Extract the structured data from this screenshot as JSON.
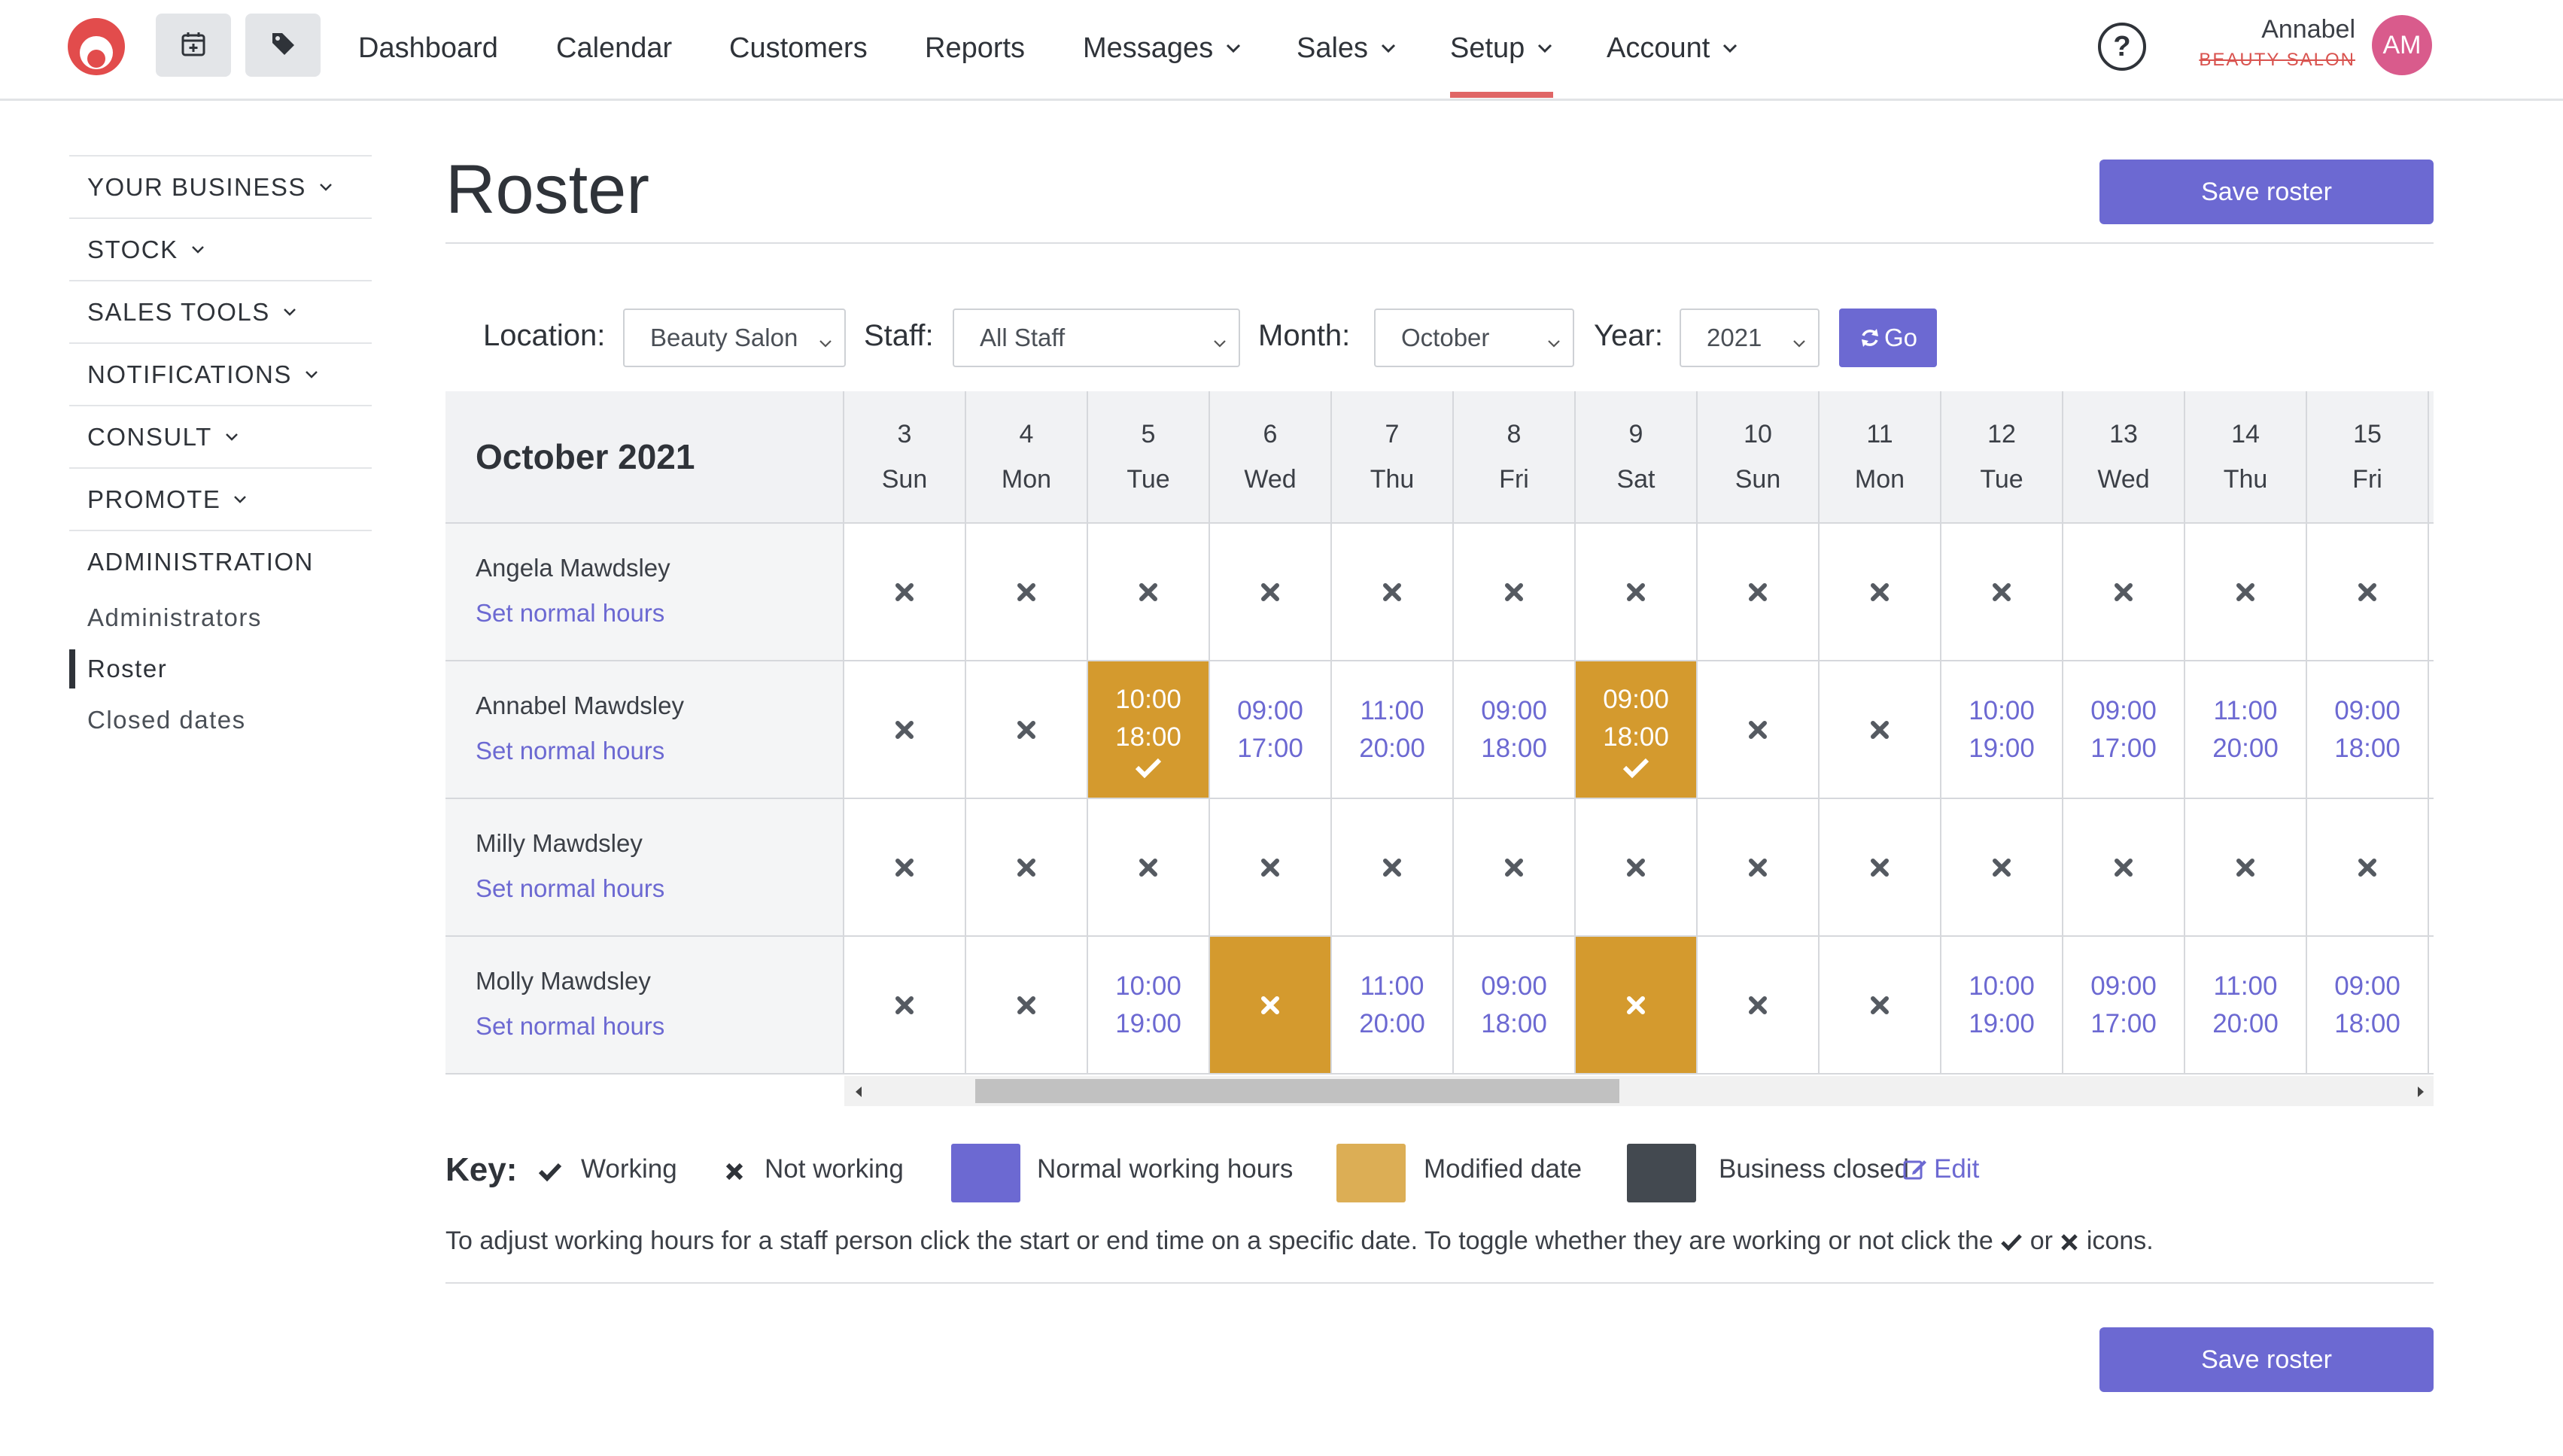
{
  "colors": {
    "accent": "#6c69d2",
    "modified": "#d49a2e",
    "modified_key": "#dcae55",
    "closed": "#434950",
    "active_underline": "#e06666"
  },
  "nav": {
    "icons": [
      "calendar-plus-icon",
      "tag-icon"
    ],
    "items": [
      {
        "label": "Dashboard"
      },
      {
        "label": "Calendar"
      },
      {
        "label": "Customers"
      },
      {
        "label": "Reports"
      },
      {
        "label": "Messages"
      },
      {
        "label": "Sales"
      },
      {
        "label": "Setup"
      },
      {
        "label": "Account"
      }
    ],
    "help": "?",
    "user_name": "Annabel",
    "business": "BEAUTY SALON",
    "avatar": "AM"
  },
  "sidebar": {
    "sections": [
      {
        "label": "YOUR BUSINESS"
      },
      {
        "label": "STOCK"
      },
      {
        "label": "SALES TOOLS"
      },
      {
        "label": "NOTIFICATIONS"
      },
      {
        "label": "CONSULT"
      },
      {
        "label": "PROMOTE"
      },
      {
        "label": "ADMINISTRATION"
      }
    ],
    "sub_items": [
      {
        "label": "Administrators"
      },
      {
        "label": "Roster"
      },
      {
        "label": "Closed dates"
      }
    ]
  },
  "page": {
    "title": "Roster",
    "save_label": "Save roster"
  },
  "filters": {
    "location_label": "Location:",
    "location_value": "Beauty Salon",
    "staff_label": "Staff:",
    "staff_value": "All Staff",
    "month_label": "Month:",
    "month_value": "October",
    "year_label": "Year:",
    "year_value": "2021",
    "go_label": "Go"
  },
  "roster": {
    "month_title": "October 2021",
    "days": [
      {
        "num": "3",
        "dow": "Sun"
      },
      {
        "num": "4",
        "dow": "Mon"
      },
      {
        "num": "5",
        "dow": "Tue"
      },
      {
        "num": "6",
        "dow": "Wed"
      },
      {
        "num": "7",
        "dow": "Thu"
      },
      {
        "num": "8",
        "dow": "Fri"
      },
      {
        "num": "9",
        "dow": "Sat"
      },
      {
        "num": "10",
        "dow": "Sun"
      },
      {
        "num": "11",
        "dow": "Mon"
      },
      {
        "num": "12",
        "dow": "Tue"
      },
      {
        "num": "13",
        "dow": "Wed"
      },
      {
        "num": "14",
        "dow": "Thu"
      },
      {
        "num": "15",
        "dow": "Fri"
      }
    ],
    "set_hours_label": "Set normal hours",
    "staff": [
      {
        "name": "Angela Mawdsley",
        "cells": [
          {
            "state": "off"
          },
          {
            "state": "off"
          },
          {
            "state": "off"
          },
          {
            "state": "off"
          },
          {
            "state": "off"
          },
          {
            "state": "off"
          },
          {
            "state": "off"
          },
          {
            "state": "off"
          },
          {
            "state": "off"
          },
          {
            "state": "off"
          },
          {
            "state": "off"
          },
          {
            "state": "off"
          },
          {
            "state": "off"
          }
        ]
      },
      {
        "name": "Annabel Mawdsley",
        "cells": [
          {
            "state": "off"
          },
          {
            "state": "off"
          },
          {
            "state": "work",
            "start": "10:00",
            "end": "18:00",
            "modified": true
          },
          {
            "state": "work",
            "start": "09:00",
            "end": "17:00"
          },
          {
            "state": "work",
            "start": "11:00",
            "end": "20:00"
          },
          {
            "state": "work",
            "start": "09:00",
            "end": "18:00"
          },
          {
            "state": "work",
            "start": "09:00",
            "end": "18:00",
            "modified": true
          },
          {
            "state": "off"
          },
          {
            "state": "off"
          },
          {
            "state": "work",
            "start": "10:00",
            "end": "19:00"
          },
          {
            "state": "work",
            "start": "09:00",
            "end": "17:00"
          },
          {
            "state": "work",
            "start": "11:00",
            "end": "20:00"
          },
          {
            "state": "work",
            "start": "09:00",
            "end": "18:00"
          }
        ]
      },
      {
        "name": "Milly Mawdsley",
        "cells": [
          {
            "state": "off"
          },
          {
            "state": "off"
          },
          {
            "state": "off"
          },
          {
            "state": "off"
          },
          {
            "state": "off"
          },
          {
            "state": "off"
          },
          {
            "state": "off"
          },
          {
            "state": "off"
          },
          {
            "state": "off"
          },
          {
            "state": "off"
          },
          {
            "state": "off"
          },
          {
            "state": "off"
          },
          {
            "state": "off"
          }
        ]
      },
      {
        "name": "Molly Mawdsley",
        "cells": [
          {
            "state": "off"
          },
          {
            "state": "off"
          },
          {
            "state": "work",
            "start": "10:00",
            "end": "19:00"
          },
          {
            "state": "off",
            "modified": true
          },
          {
            "state": "work",
            "start": "11:00",
            "end": "20:00"
          },
          {
            "state": "work",
            "start": "09:00",
            "end": "18:00"
          },
          {
            "state": "off",
            "modified": true
          },
          {
            "state": "off"
          },
          {
            "state": "off"
          },
          {
            "state": "work",
            "start": "10:00",
            "end": "19:00"
          },
          {
            "state": "work",
            "start": "09:00",
            "end": "17:00"
          },
          {
            "state": "work",
            "start": "11:00",
            "end": "20:00"
          },
          {
            "state": "work",
            "start": "09:00",
            "end": "18:00"
          }
        ]
      }
    ]
  },
  "key": {
    "label": "Key:",
    "working": "Working",
    "not_working": "Not working",
    "normal_hours": "Normal working hours",
    "modified": "Modified date",
    "closed": "Business closed",
    "edit": "Edit",
    "note_before": "To adjust working hours for a staff person click the start or end time on a specific date. To toggle whether they are working or not click the",
    "note_or": "or",
    "note_after": "icons."
  }
}
